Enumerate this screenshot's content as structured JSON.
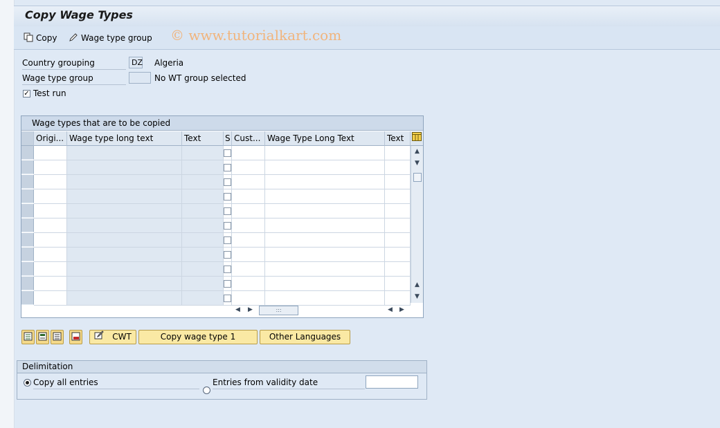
{
  "window": {
    "title": "Copy Wage Types"
  },
  "watermark": "© www.tutorialkart.com",
  "toolbar": {
    "copy_label": "Copy",
    "wtgroup_label": "Wage type group"
  },
  "form": {
    "country_label": "Country grouping",
    "country_value": "DZ",
    "country_text": "Algeria",
    "wtg_label": "Wage type group",
    "wtg_value": "",
    "wtg_text": "No WT group selected",
    "testrun_label": "Test run",
    "testrun_checked": true
  },
  "grid": {
    "title": "Wage types that are to be copied",
    "columns": [
      "Origi...",
      "Wage type long text",
      "Text",
      "S",
      "Cust...",
      "Wage Type Long Text",
      "Text"
    ],
    "rows": [
      {},
      {},
      {},
      {},
      {},
      {},
      {},
      {},
      {},
      {},
      {}
    ]
  },
  "buttons": {
    "cwt": "CWT",
    "copy_wage_type": "Copy wage type 1",
    "other_languages": "Other Languages"
  },
  "delimitation": {
    "title": "Delimitation",
    "copy_all": "Copy all entries",
    "from_validity": "Entries from validity date",
    "selected": "copy_all",
    "validity_date": ""
  }
}
